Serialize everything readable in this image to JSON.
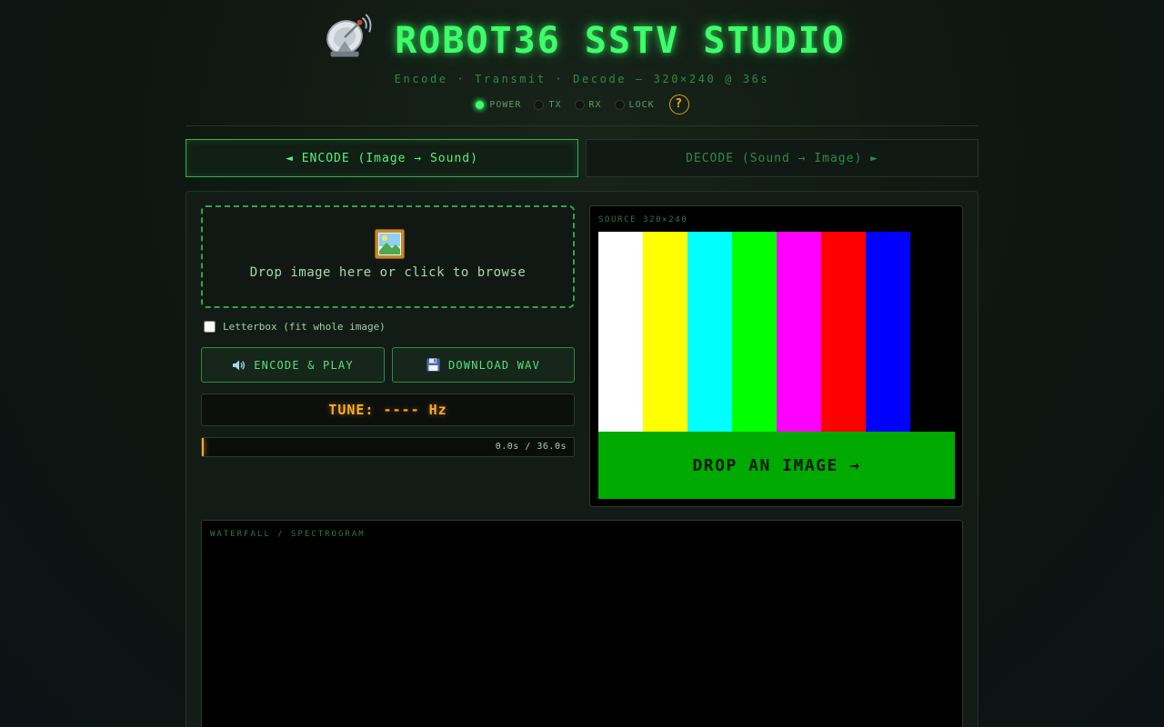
{
  "header": {
    "title": "ROBOT36 SSTV STUDIO",
    "subtitle": "Encode · Transmit · Decode — 320×240 @ 36s",
    "icon": "satellite-dish-icon",
    "status_leds": [
      {
        "label": "POWER",
        "on": true
      },
      {
        "label": "TX",
        "on": false
      },
      {
        "label": "RX",
        "on": false
      },
      {
        "label": "LOCK",
        "on": false
      }
    ],
    "help_label": "?"
  },
  "tabs": [
    {
      "label": "◄ ENCODE (Image → Sound)",
      "active": true
    },
    {
      "label": "DECODE (Sound → Image) ►",
      "active": false
    }
  ],
  "encode": {
    "dropzone_icon": "framed-picture-icon",
    "dropzone_text": "Drop image here or click to browse",
    "letterbox_label": "Letterbox (fit whole image)",
    "letterbox_checked": false,
    "encode_button": "ENCODE & PLAY",
    "encode_icon": "speaker-icon",
    "download_button": "DOWNLOAD WAV",
    "download_icon": "floppy-disk-icon",
    "tune_label": "TUNE: ---- Hz",
    "progress_text": "0.0s / 36.0s",
    "progress_fraction": 0.0
  },
  "source": {
    "label": "SOURCE 320×240",
    "color_bars": [
      "#ffffff",
      "#ffff00",
      "#00ffff",
      "#00ff00",
      "#ff00ff",
      "#ff0000",
      "#0000ff",
      "#000000"
    ],
    "banner_text": "DROP AN IMAGE →",
    "banner_color": "#00aa00"
  },
  "waterfall": {
    "label": "WATERFALL / SPECTROGRAM"
  },
  "colors": {
    "accent": "#3dff6a",
    "tune": "#ffaa22"
  }
}
